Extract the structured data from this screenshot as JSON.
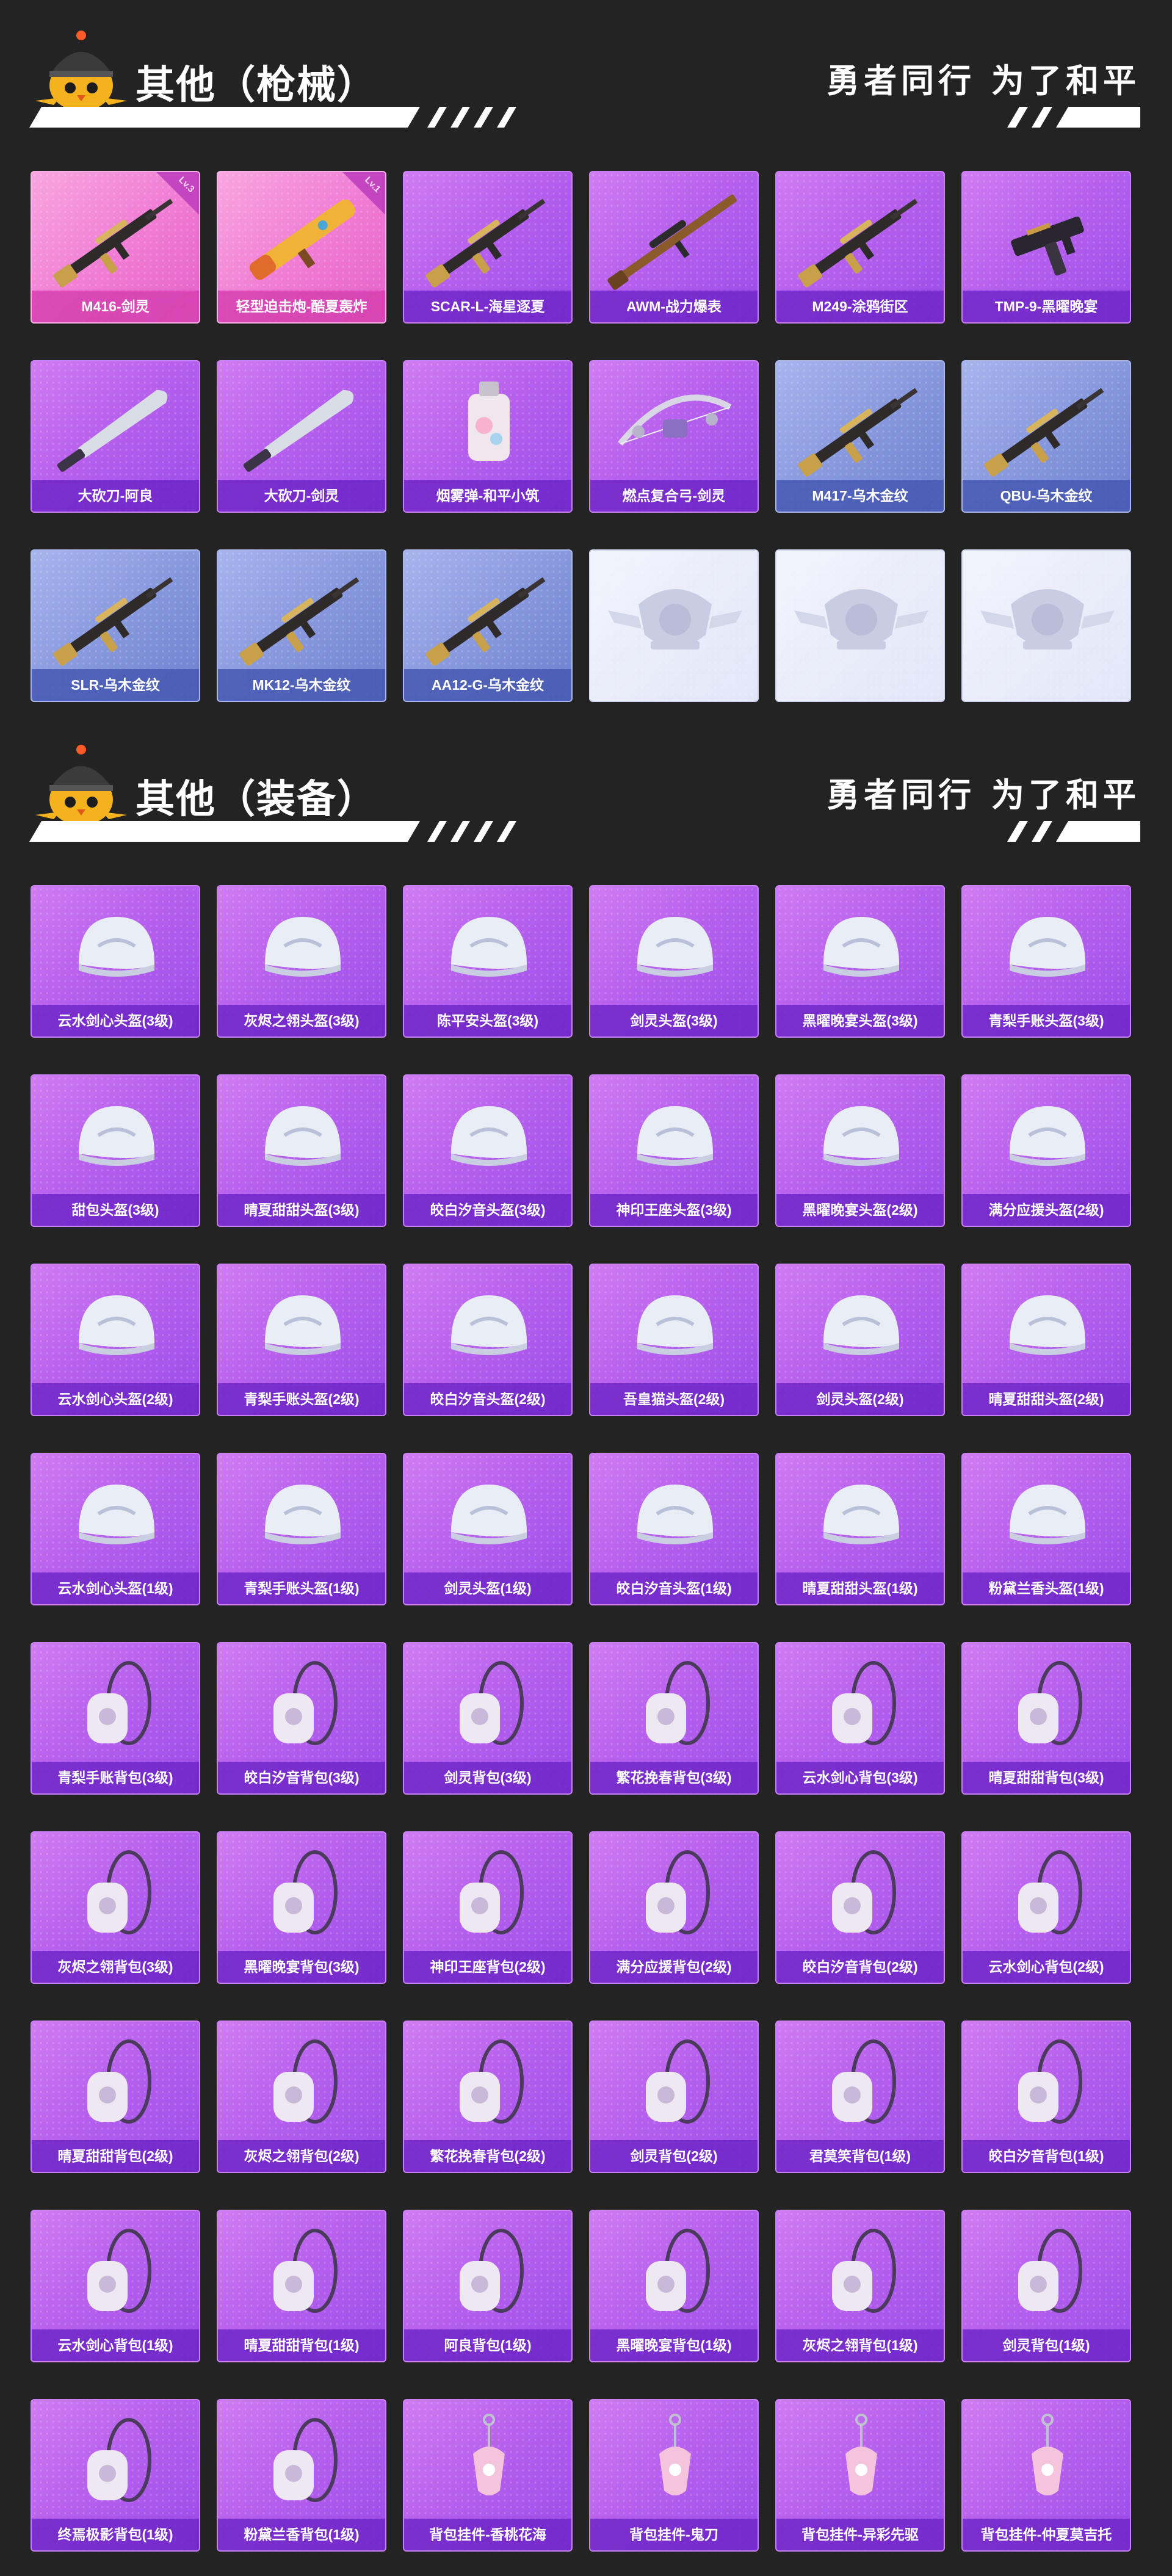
{
  "sections": [
    {
      "title": "其他（枪械）",
      "slogan": "勇者同行 为了和平",
      "items": [
        {
          "label": "M416-剑灵",
          "style": "pink",
          "kind": "rifle",
          "badge": "Lv.3"
        },
        {
          "label": "轻型迫击炮-酷夏轰炸",
          "style": "pink",
          "kind": "launcher",
          "badge": "Lv.1"
        },
        {
          "label": "SCAR-L-海星逐夏",
          "style": "purple",
          "kind": "rifle"
        },
        {
          "label": "AWM-战力爆表",
          "style": "purple",
          "kind": "sniper"
        },
        {
          "label": "M249-涂鸦街区",
          "style": "purple",
          "kind": "rifle"
        },
        {
          "label": "TMP-9-黑曜晚宴",
          "style": "purple",
          "kind": "smg"
        },
        {
          "label": "大砍刀-阿良",
          "style": "purple",
          "kind": "blade"
        },
        {
          "label": "大砍刀-剑灵",
          "style": "purple",
          "kind": "blade"
        },
        {
          "label": "烟雾弹-和平小筑",
          "style": "purple",
          "kind": "grenade"
        },
        {
          "label": "燃点复合弓-剑灵",
          "style": "purple",
          "kind": "bow"
        },
        {
          "label": "M417-乌木金纹",
          "style": "blue",
          "kind": "rifle"
        },
        {
          "label": "QBU-乌木金纹",
          "style": "blue",
          "kind": "rifle"
        },
        {
          "label": "SLR-乌木金纹",
          "style": "blue",
          "kind": "rifle"
        },
        {
          "label": "MK12-乌木金纹",
          "style": "blue",
          "kind": "rifle"
        },
        {
          "label": "AA12-G-乌木金纹",
          "style": "blue",
          "kind": "rifle"
        },
        {
          "label": "",
          "style": "empty",
          "kind": "emblem"
        },
        {
          "label": "",
          "style": "empty",
          "kind": "emblem"
        },
        {
          "label": "",
          "style": "empty",
          "kind": "emblem"
        }
      ]
    },
    {
      "title": "其他（装备）",
      "slogan": "勇者同行 为了和平",
      "items": [
        {
          "label": "云水剑心头盔(3级)",
          "style": "purple",
          "kind": "helmet"
        },
        {
          "label": "灰烬之翎头盔(3级)",
          "style": "purple",
          "kind": "helmet"
        },
        {
          "label": "陈平安头盔(3级)",
          "style": "purple",
          "kind": "helmet"
        },
        {
          "label": "剑灵头盔(3级)",
          "style": "purple",
          "kind": "helmet"
        },
        {
          "label": "黑曜晚宴头盔(3级)",
          "style": "purple",
          "kind": "helmet"
        },
        {
          "label": "青梨手账头盔(3级)",
          "style": "purple",
          "kind": "helmet"
        },
        {
          "label": "甜包头盔(3级)",
          "style": "purple",
          "kind": "helmet"
        },
        {
          "label": "晴夏甜甜头盔(3级)",
          "style": "purple",
          "kind": "helmet"
        },
        {
          "label": "皎白汐音头盔(3级)",
          "style": "purple",
          "kind": "helmet"
        },
        {
          "label": "神印王座头盔(3级)",
          "style": "purple",
          "kind": "helmet"
        },
        {
          "label": "黑曜晚宴头盔(2级)",
          "style": "purple",
          "kind": "helmet"
        },
        {
          "label": "满分应援头盔(2级)",
          "style": "purple",
          "kind": "helmet"
        },
        {
          "label": "云水剑心头盔(2级)",
          "style": "purple",
          "kind": "helmet"
        },
        {
          "label": "青梨手账头盔(2级)",
          "style": "purple",
          "kind": "helmet"
        },
        {
          "label": "皎白汐音头盔(2级)",
          "style": "purple",
          "kind": "helmet"
        },
        {
          "label": "吾皇猫头盔(2级)",
          "style": "purple",
          "kind": "helmet"
        },
        {
          "label": "剑灵头盔(2级)",
          "style": "purple",
          "kind": "helmet"
        },
        {
          "label": "晴夏甜甜头盔(2级)",
          "style": "purple",
          "kind": "helmet"
        },
        {
          "label": "云水剑心头盔(1级)",
          "style": "purple",
          "kind": "helmet"
        },
        {
          "label": "青梨手账头盔(1级)",
          "style": "purple",
          "kind": "helmet"
        },
        {
          "label": "剑灵头盔(1级)",
          "style": "purple",
          "kind": "helmet"
        },
        {
          "label": "皎白汐音头盔(1级)",
          "style": "purple",
          "kind": "helmet"
        },
        {
          "label": "晴夏甜甜头盔(1级)",
          "style": "purple",
          "kind": "helmet"
        },
        {
          "label": "粉黛兰香头盔(1级)",
          "style": "purple",
          "kind": "helmet"
        },
        {
          "label": "青梨手账背包(3级)",
          "style": "purple",
          "kind": "backpack"
        },
        {
          "label": "皎白汐音背包(3级)",
          "style": "purple",
          "kind": "backpack"
        },
        {
          "label": "剑灵背包(3级)",
          "style": "purple",
          "kind": "backpack"
        },
        {
          "label": "繁花挽春背包(3级)",
          "style": "purple",
          "kind": "backpack"
        },
        {
          "label": "云水剑心背包(3级)",
          "style": "purple",
          "kind": "backpack"
        },
        {
          "label": "晴夏甜甜背包(3级)",
          "style": "purple",
          "kind": "backpack"
        },
        {
          "label": "灰烬之翎背包(3级)",
          "style": "purple",
          "kind": "backpack"
        },
        {
          "label": "黑曜晚宴背包(3级)",
          "style": "purple",
          "kind": "backpack"
        },
        {
          "label": "神印王座背包(2级)",
          "style": "purple",
          "kind": "backpack"
        },
        {
          "label": "满分应援背包(2级)",
          "style": "purple",
          "kind": "backpack"
        },
        {
          "label": "皎白汐音背包(2级)",
          "style": "purple",
          "kind": "backpack"
        },
        {
          "label": "云水剑心背包(2级)",
          "style": "purple",
          "kind": "backpack"
        },
        {
          "label": "晴夏甜甜背包(2级)",
          "style": "purple",
          "kind": "backpack"
        },
        {
          "label": "灰烬之翎背包(2级)",
          "style": "purple",
          "kind": "backpack"
        },
        {
          "label": "繁花挽春背包(2级)",
          "style": "purple",
          "kind": "backpack"
        },
        {
          "label": "剑灵背包(2级)",
          "style": "purple",
          "kind": "backpack"
        },
        {
          "label": "君莫笑背包(1级)",
          "style": "purple",
          "kind": "backpack"
        },
        {
          "label": "皎白汐音背包(1级)",
          "style": "purple",
          "kind": "backpack"
        },
        {
          "label": "云水剑心背包(1级)",
          "style": "purple",
          "kind": "backpack"
        },
        {
          "label": "晴夏甜甜背包(1级)",
          "style": "purple",
          "kind": "backpack"
        },
        {
          "label": "阿良背包(1级)",
          "style": "purple",
          "kind": "backpack"
        },
        {
          "label": "黑曜晚宴背包(1级)",
          "style": "purple",
          "kind": "backpack"
        },
        {
          "label": "灰烬之翎背包(1级)",
          "style": "purple",
          "kind": "backpack"
        },
        {
          "label": "剑灵背包(1级)",
          "style": "purple",
          "kind": "backpack"
        },
        {
          "label": "终焉极影背包(1级)",
          "style": "purple",
          "kind": "backpack"
        },
        {
          "label": "粉黛兰香背包(1级)",
          "style": "purple",
          "kind": "backpack"
        },
        {
          "label": "背包挂件-香桃花海",
          "style": "purple",
          "kind": "charm"
        },
        {
          "label": "背包挂件-鬼刀",
          "style": "purple",
          "kind": "charm"
        },
        {
          "label": "背包挂件-异彩先驱",
          "style": "purple",
          "kind": "charm"
        },
        {
          "label": "背包挂件-仲夏莫吉托",
          "style": "purple",
          "kind": "charm"
        }
      ]
    }
  ],
  "colors": {
    "background": "#232323",
    "card_purple": "#b760ee",
    "card_pink": "#f07bd4",
    "card_blue": "#8596dc",
    "card_empty": "#e8ebf9",
    "title_text": "#ffffff"
  },
  "icons": {
    "mascot": "chick-helmet-mascot-icon",
    "rifle": "rifle-icon",
    "launcher": "launcher-icon",
    "sniper": "sniper-rifle-icon",
    "smg": "smg-icon",
    "blade": "machete-icon",
    "grenade": "smoke-grenade-icon",
    "bow": "compound-bow-icon",
    "emblem": "placeholder-emblem-icon",
    "helmet": "helmet-icon",
    "backpack": "backpack-icon",
    "charm": "backpack-charm-icon"
  }
}
